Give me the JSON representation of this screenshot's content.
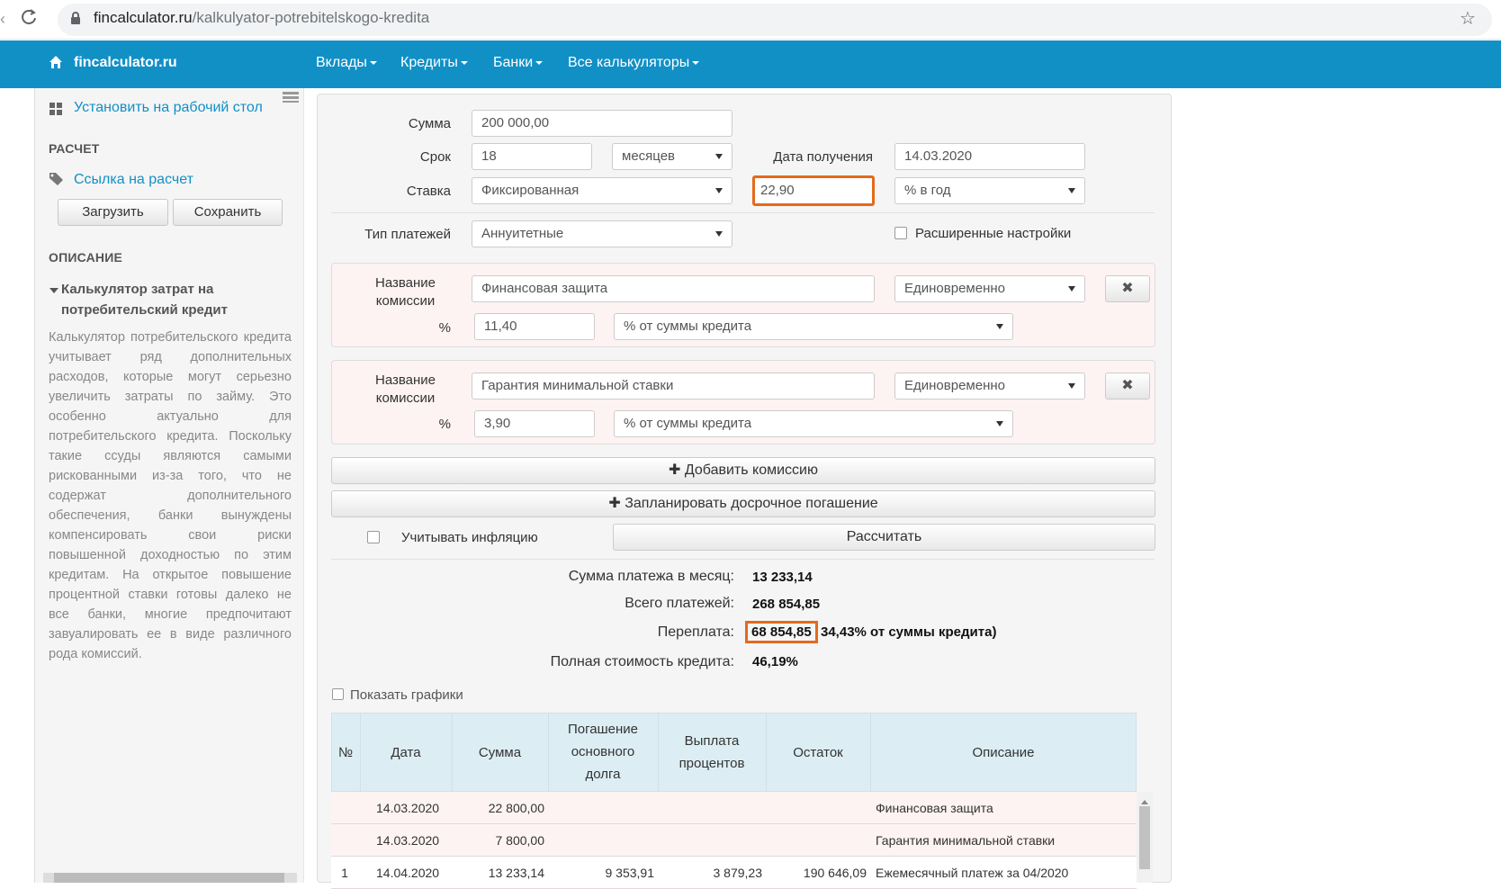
{
  "browser": {
    "url_host": "fincalculator.ru",
    "url_path": "/kalkulyator-potrebitelskogo-kredita"
  },
  "navbar": {
    "brand": "fincalculator.ru",
    "items": [
      "Вклады",
      "Кредиты",
      "Банки",
      "Все калькуляторы"
    ]
  },
  "sidebar": {
    "install_link": "Установить на рабочий стол",
    "calc_heading": "РАСЧЕТ",
    "calc_link": "Ссылка на расчет",
    "load_button": "Загрузить",
    "save_button": "Сохранить",
    "desc_heading": "ОПИСАНИЕ",
    "desc_title": "Калькулятор затрат на потребительский кредит",
    "desc_text": "Калькулятор потребительского кредита учитывает ряд дополнительных расходов, которые могут серьезно увеличить затраты по займу. Это особенно актуально для потребительского кредита. Поскольку такие ссуды являются самыми рискованными из-за того, что не содержат дополнительного обеспечения, банки вынуждены компенсировать свои риски повышенной доходностью по этим кредитам. На открытое повышение процентной ставки готовы далеко не все банки, многие предпочитают завуалировать ее в виде различного рода комиссий."
  },
  "form": {
    "sum_label": "Сумма",
    "sum_value": "200 000,00",
    "term_label": "Срок",
    "term_value": "18",
    "term_unit": "месяцев",
    "date_label": "Дата получения",
    "date_value": "14.03.2020",
    "rate_label": "Ставка",
    "rate_type": "Фиксированная",
    "rate_value": "22,90",
    "rate_unit": "% в год",
    "payment_type_label": "Тип платежей",
    "payment_type": "Аннуитетные",
    "advanced_label": "Расширенные настройки",
    "commissions": [
      {
        "name_label": "Название комиссии",
        "name": "Финансовая защита",
        "frequency": "Единовременно",
        "percent_label": "%",
        "percent": "11,40",
        "base": "% от суммы кредита"
      },
      {
        "name_label": "Название комиссии",
        "name": "Гарантия минимальной ставки",
        "frequency": "Единовременно",
        "percent_label": "%",
        "percent": "3,90",
        "base": "% от суммы кредита"
      }
    ],
    "add_commission": "Добавить комиссию",
    "plan_early": "Запланировать досрочное погашение",
    "inflation_label": "Учитывать инфляцию",
    "calculate": "Рассчитать"
  },
  "results": {
    "monthly_label": "Сумма платежа в месяц:",
    "monthly_value": "13 233,14",
    "total_label": "Всего платежей:",
    "total_value": "268 854,85",
    "overpay_label": "Переплата:",
    "overpay_value": "68 854,85",
    "overpay_note": "34,43% от суммы кредита)",
    "full_cost_label": "Полная стоимость кредита:",
    "full_cost_value": "46,19%"
  },
  "show_charts_label": "Показать графики",
  "table": {
    "headers": [
      "№",
      "Дата",
      "Сумма",
      "Погашение основного долга",
      "Выплата процентов",
      "Остаток",
      "Описание"
    ],
    "rows": [
      {
        "n": "",
        "date": "14.03.2020",
        "sum": "22 800,00",
        "principal": "",
        "interest": "",
        "balance": "",
        "desc": "Финансовая защита",
        "fee": true
      },
      {
        "n": "",
        "date": "14.03.2020",
        "sum": "7 800,00",
        "principal": "",
        "interest": "",
        "balance": "",
        "desc": "Гарантия минимальной ставки",
        "fee": true
      },
      {
        "n": "1",
        "date": "14.04.2020",
        "sum": "13 233,14",
        "principal": "9 353,91",
        "interest": "3 879,23",
        "balance": "190 646,09",
        "desc": "Ежемесячный платеж за 04/2020",
        "fee": false
      }
    ]
  },
  "colors": {
    "navbar": "#1190c6",
    "link": "#1190c6",
    "highlight": "#e46a1b",
    "table_header": "#dceef4",
    "fee_row": "#fdf3f2"
  }
}
